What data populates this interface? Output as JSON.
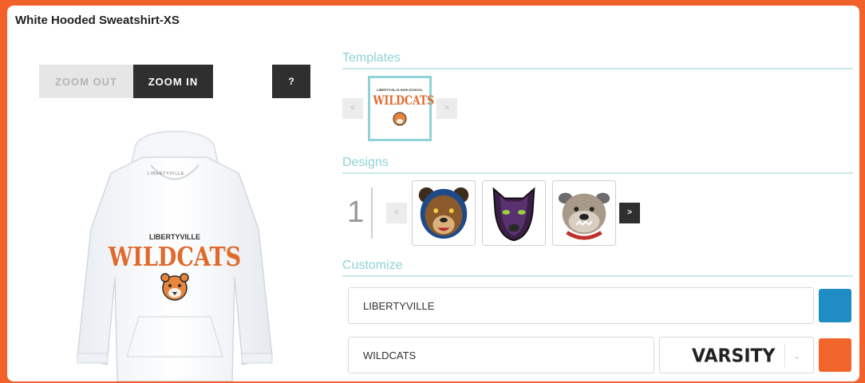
{
  "product": {
    "title": "White Hooded Sweatshirt-XS"
  },
  "zoom": {
    "zoom_out_label": "ZOOM OUT",
    "zoom_in_label": "ZOOM IN",
    "help_label": "?"
  },
  "preview": {
    "school_line": "LIBERTYVILLE",
    "team_line": "WILDCATS",
    "tag_text": "LIBERTYVILLE"
  },
  "templates": {
    "title": "Templates",
    "prev_label": "<",
    "next_label": ">",
    "items": [
      {
        "top_text": "LIBERTYVILLE HIGH SCHOOL",
        "main_text": "WILDCATS"
      }
    ]
  },
  "designs": {
    "title": "Designs",
    "page": "1",
    "prev_label": "<",
    "next_label": ">",
    "items": [
      {
        "icon": "bear-icon"
      },
      {
        "icon": "panther-icon"
      },
      {
        "icon": "bulldog-icon"
      }
    ]
  },
  "customize": {
    "title": "Customize",
    "line1_value": "LIBERTYVILLE",
    "line1_color": "#1f8dc4",
    "line2_value": "WILDCATS",
    "line2_font": "VARSITY",
    "line2_color": "#f2652b",
    "chevron": "⌄"
  },
  "colors": {
    "accent": "#8fd3d6",
    "frame": "#f2612a",
    "dark_button": "#2f2f2f",
    "lettering": "#e06a2c"
  }
}
